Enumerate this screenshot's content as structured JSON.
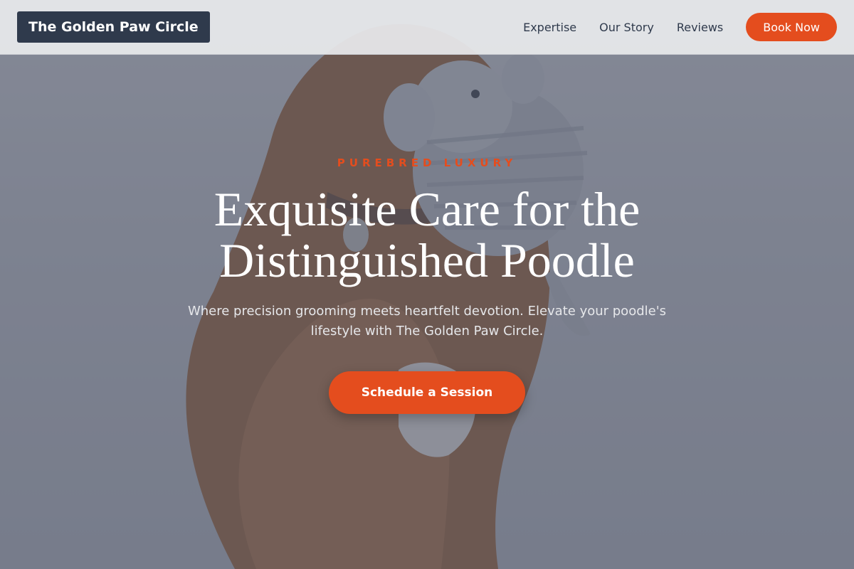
{
  "header": {
    "brand": "The Golden Paw Circle",
    "nav": [
      "Expertise",
      "Our Story",
      "Reviews"
    ],
    "book_label": "Book Now"
  },
  "hero": {
    "eyebrow": "PUREBRED LUXURY",
    "headline": "Exquisite Care for the Distinguished Poodle",
    "subtext": "Where precision grooming meets heartfelt devotion. Elevate your poodle's lifestyle with The Golden Paw Circle.",
    "cta_label": "Schedule a Session",
    "image": "dog-holding-plush-elephant-photo"
  },
  "colors": {
    "accent": "#e44d1e",
    "brand_bg": "#2f3a4c",
    "header_bg": "#e8e9ec",
    "overlay": "#464e62"
  }
}
